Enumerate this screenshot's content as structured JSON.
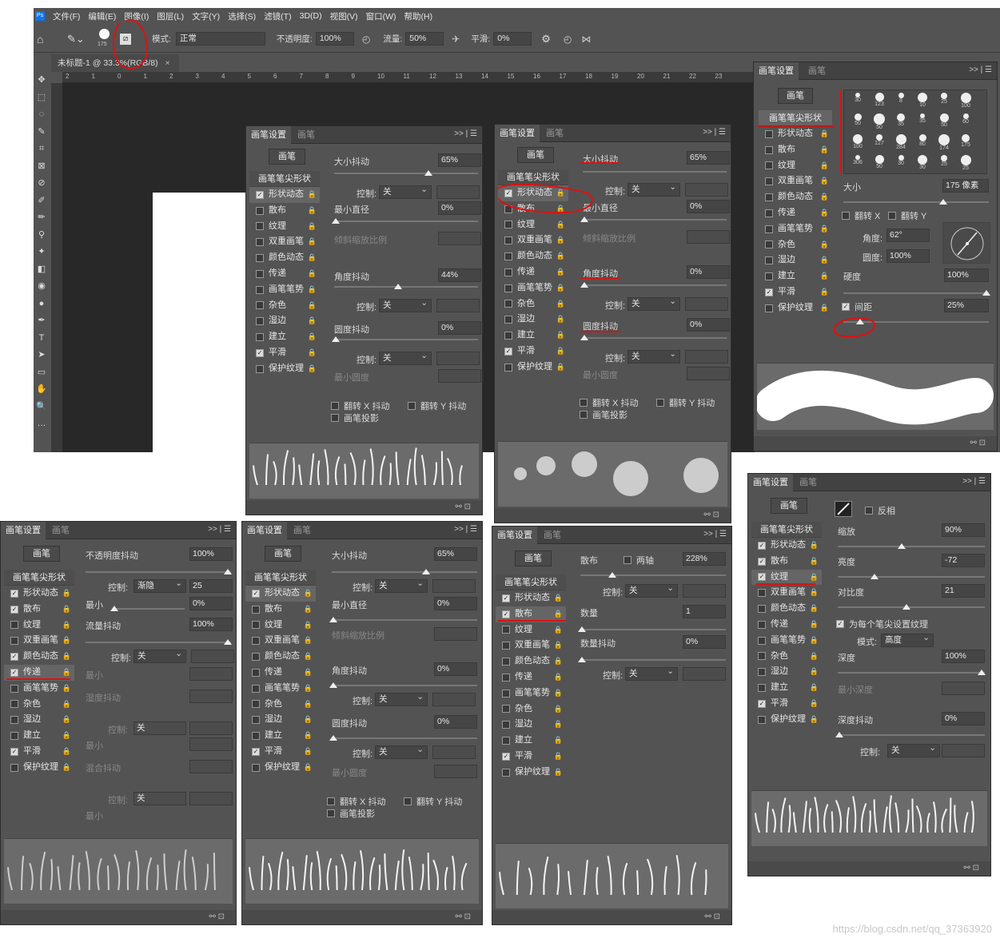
{
  "menubar": {
    "logo": "Ps",
    "items": [
      "文件(F)",
      "编辑(E)",
      "图像(I)",
      "图层(L)",
      "文字(Y)",
      "选择(S)",
      "滤镜(T)",
      "3D(D)",
      "视图(V)",
      "窗口(W)",
      "帮助(H)"
    ]
  },
  "options": {
    "brush_size": "175",
    "mode_label": "模式:",
    "mode_value": "正常",
    "opacity_label": "不透明度:",
    "opacity_value": "100%",
    "flow_label": "流量:",
    "flow_value": "50%",
    "smooth_label": "平滑:",
    "smooth_value": "0%"
  },
  "document": {
    "tab_title": "未标题-1 @ 33.3%(RGB/8)",
    "close": "×",
    "ruler_numbers": [
      "2",
      "1",
      "0",
      "1",
      "2",
      "3",
      "4",
      "5",
      "6",
      "7",
      "8",
      "9",
      "10",
      "11",
      "12",
      "13",
      "14",
      "15",
      "16",
      "17",
      "18",
      "19",
      "20",
      "21",
      "22",
      "23"
    ]
  },
  "tools": [
    "✥",
    "⬚",
    "◌",
    "✎",
    "⌗",
    "⊠",
    "⊘",
    "✐",
    "✏",
    "⚲",
    "✦",
    "◧",
    "◉",
    "●",
    "✒",
    "T",
    "➤",
    "▭",
    "✋",
    "🔍",
    "…"
  ],
  "common": {
    "tab_settings": "画笔设置",
    "tab_brush": "画笔",
    "brush_btn": "画笔",
    "tip_shape": "画笔笔尖形状",
    "menu": ">> | ☰",
    "footer": "⚯ ⊡",
    "control_label": "控制:",
    "control_off": "关",
    "flip_x": "翻转 X 抖动",
    "flip_y": "翻转 Y 抖动",
    "brush_proj": "画笔投影",
    "lock": "🔒"
  },
  "list_items": [
    "形状动态",
    "散布",
    "纹理",
    "双重画笔",
    "颜色动态",
    "传递",
    "画笔笔势",
    "杂色",
    "湿边",
    "建立",
    "平滑",
    "保护纹理"
  ],
  "shape_dyn": {
    "size_jitter": "大小抖动",
    "size_val": "65%",
    "min_dia": "最小直径",
    "min_val": "0%",
    "tilt_scale": "倾斜缩放比例",
    "angle_jitter": "角度抖动",
    "angle_val_a": "44%",
    "angle_val_b": "0%",
    "round_jitter": "圆度抖动",
    "round_val": "0%",
    "min_round": "最小圆度"
  },
  "tip": {
    "size_label": "大小",
    "size_val": "175 像素",
    "flip_x": "翻转 X",
    "flip_y": "翻转 Y",
    "angle_label": "角度:",
    "angle_val": "62°",
    "round_label": "圆度:",
    "round_val": "100%",
    "hard_label": "硬度",
    "hard_val": "100%",
    "spacing_label": "间距",
    "spacing_val": "25%",
    "brush_sizes": [
      "30",
      "123",
      "8",
      "10",
      "25",
      "100",
      "50",
      "50",
      "35",
      "35",
      "50",
      "60",
      "100",
      "127",
      "284",
      "80",
      "174",
      "175",
      "306",
      "50",
      "30",
      "30",
      "25",
      "25"
    ]
  },
  "transfer": {
    "opacity_jitter": "不透明度抖动",
    "op_val": "100%",
    "control_val": "渐隐",
    "ctrl_num": "25",
    "min": "最小",
    "min_val": "0%",
    "flow_jitter": "流量抖动",
    "flow_val": "100%",
    "wet_jitter": "湿度抖动",
    "mix_jitter": "混合抖动"
  },
  "scatter": {
    "scatter_label": "散布",
    "both_axes": "两轴",
    "scatter_val": "228%",
    "count": "数量",
    "count_val": "1",
    "count_jitter": "数量抖动",
    "count_jitter_val": "0%"
  },
  "texture": {
    "invert": "反相",
    "scale": "缩放",
    "scale_val": "90%",
    "brightness": "亮度",
    "bright_val": "-72",
    "contrast": "对比度",
    "contrast_val": "21",
    "per_tip": "为每个笔尖设置纹理",
    "mode_label": "模式:",
    "mode_val": "高度",
    "depth": "深度",
    "depth_val": "100%",
    "min_depth": "最小深度",
    "depth_jitter": "深度抖动",
    "depth_jitter_val": "0%"
  },
  "watermark": "https://blog.csdn.net/qq_37363920",
  "colors": {
    "panel": "#535353",
    "annotation": "#e01010"
  }
}
